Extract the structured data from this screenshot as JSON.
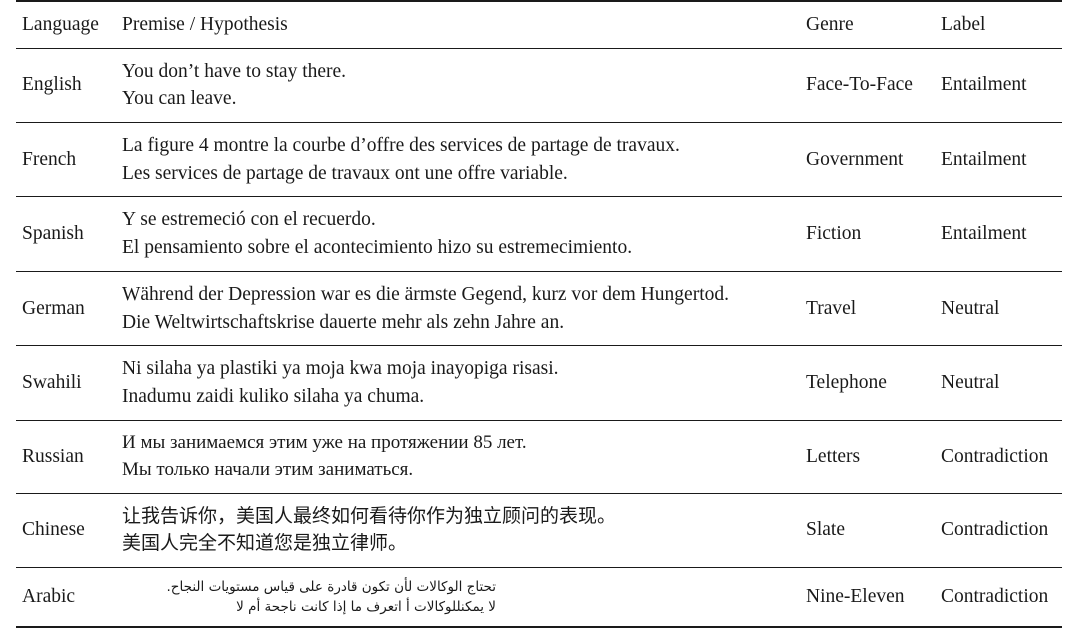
{
  "table": {
    "columns": [
      "Language",
      "Premise / Hypothesis",
      "Genre",
      "Label"
    ],
    "rows": [
      {
        "language": "English",
        "premise": "You don’t have to stay there.",
        "hypothesis": "You can leave.",
        "genre": "Face-To-Face",
        "label": "Entailment"
      },
      {
        "language": "French",
        "premise": "La figure 4 montre la courbe d’offre des services de partage de travaux.",
        "hypothesis": "Les services de partage de travaux ont une offre variable.",
        "genre": "Government",
        "label": "Entailment"
      },
      {
        "language": "Spanish",
        "premise": "Y se estremeció con el recuerdo.",
        "hypothesis": "El pensamiento sobre el acontecimiento hizo su estremecimiento.",
        "genre": "Fiction",
        "label": "Entailment"
      },
      {
        "language": "German",
        "premise": "Während der Depression war es die ärmste Gegend, kurz vor dem Hungertod.",
        "hypothesis": "Die Weltwirtschaftskrise dauerte mehr als zehn Jahre an.",
        "genre": "Travel",
        "label": "Neutral"
      },
      {
        "language": "Swahili",
        "premise": "Ni silaha ya plastiki ya moja kwa moja inayopiga risasi.",
        "hypothesis": "Inadumu zaidi kuliko silaha ya chuma.",
        "genre": "Telephone",
        "label": "Neutral"
      },
      {
        "language": "Russian",
        "premise": "И мы занимаемся этим уже на протяжении 85 лет.",
        "hypothesis": "Мы только начали этим заниматься.",
        "genre": "Letters",
        "label": "Contradiction"
      },
      {
        "language": "Chinese",
        "premise": "让我告诉你，美国人最终如何看待你作为独立顾问的表现。",
        "hypothesis": "美国人完全不知道您是独立律师。",
        "genre": "Slate",
        "label": "Contradiction"
      },
      {
        "language": "Arabic",
        "premise": "تحتاج الوكالات لأن تكون قادرة على قياس مستويات النجاح.",
        "hypothesis": "لا يمكنللوكالات أ اتعرف ما إذا كانت ناجحة أم لا",
        "genre": "Nine-Eleven",
        "label": "Contradiction"
      }
    ]
  }
}
